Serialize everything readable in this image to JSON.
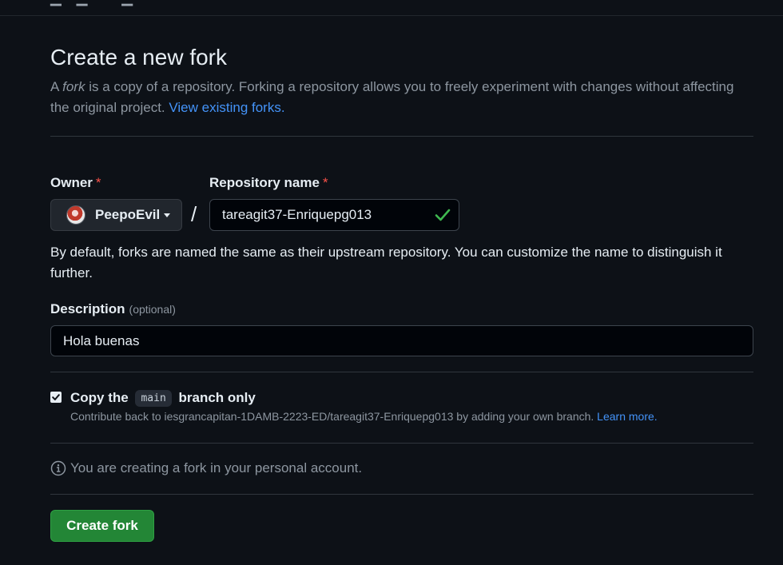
{
  "form": {
    "title": "Create a new fork",
    "subtitle_pre": "A ",
    "subtitle_em": "fork",
    "subtitle_post": " is a copy of a repository. Forking a repository allows you to freely experiment with changes without affecting the original project. ",
    "view_forks_link": "View existing forks.",
    "owner_label": "Owner",
    "required_mark": "*",
    "owner_name": "PeepoEvil",
    "separator": "/",
    "repo_label": "Repository name",
    "repo_value": "tareagit37-Enriquepg013",
    "repo_help": "By default, forks are named the same as their upstream repository. You can customize the name to distinguish it further.",
    "description_label": "Description",
    "description_optional": "(optional)",
    "description_value": "Hola buenas",
    "copy_branch_pre": "Copy the",
    "copy_branch_code": "main",
    "copy_branch_post": "branch only",
    "copy_branch_checked": true,
    "copy_note_text": "Contribute back to iesgrancapitan-1DAMB-2223-ED/tareagit37-Enriquepg013 by adding your own branch.",
    "learn_more_link": "Learn more.",
    "account_info": "You are creating a fork in your personal account.",
    "create_button": "Create fork"
  },
  "icons": {
    "repo_valid": "check-icon",
    "owner_dropdown": "caret-down-icon",
    "info": "info-icon",
    "checkbox": "checkbox-checked-icon"
  },
  "colors": {
    "background": "#0d1117",
    "link": "#4493f8",
    "required": "#f85149",
    "success": "#3fb950",
    "primary_button": "#238636"
  }
}
